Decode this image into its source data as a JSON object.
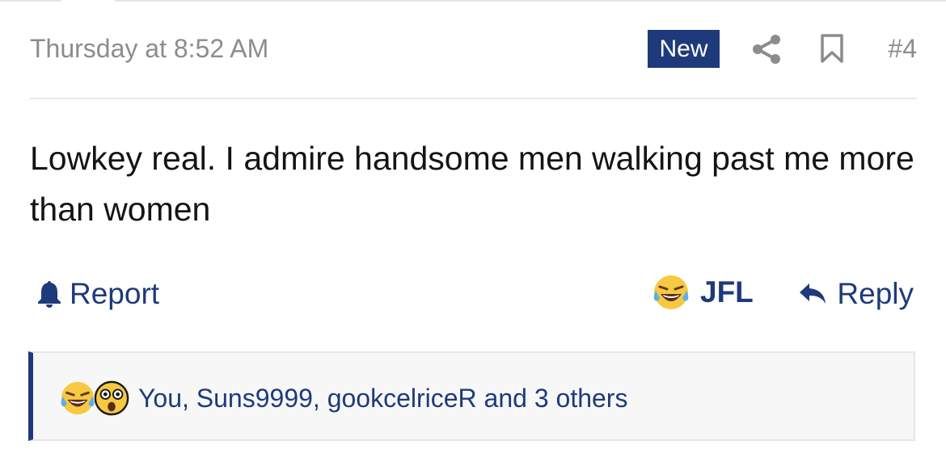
{
  "post": {
    "timestamp": "Thursday at 8:52 AM",
    "badge": "New",
    "post_number": "#4",
    "message": "Lowkey real. I admire handsome men walking past me more than women"
  },
  "actions": {
    "report_label": "Report",
    "reaction_label": "JFL",
    "reply_label": "Reply"
  },
  "reactions": {
    "summary": "You, Suns9999, gookcelriceR and 3 others",
    "emojis": [
      "laughing-crying-emoji",
      "astonished-emoji"
    ]
  },
  "colors": {
    "accent": "#1f3a7a",
    "muted_text": "#8c8c8c",
    "body_text": "#141414",
    "reaction_bg": "#f7f7f7"
  },
  "icons": {
    "share": "share-icon",
    "bookmark": "bookmark-icon",
    "report": "bell-icon",
    "reply": "reply-arrow-icon"
  }
}
